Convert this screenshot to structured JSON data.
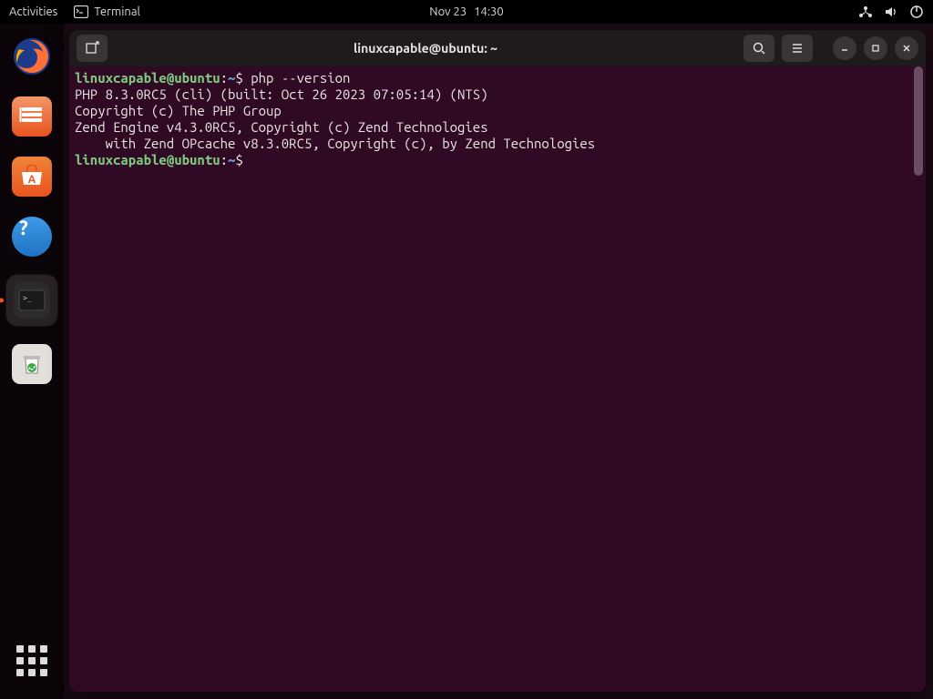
{
  "topbar": {
    "activities": "Activities",
    "app_label": "Terminal",
    "date": "Nov 23",
    "time": "14:30"
  },
  "dock": {
    "items": [
      {
        "name": "firefox",
        "label": "Firefox"
      },
      {
        "name": "files",
        "label": "Files"
      },
      {
        "name": "software",
        "label": "Ubuntu Software"
      },
      {
        "name": "help",
        "label": "Help"
      },
      {
        "name": "terminal",
        "label": "Terminal",
        "active": true
      },
      {
        "name": "trash",
        "label": "Trash"
      }
    ],
    "apps_button": "Show Applications"
  },
  "window": {
    "title": "linuxcapable@ubuntu: ~",
    "buttons": {
      "new_tab": "New Tab",
      "search": "Search",
      "menu": "Menu",
      "min": "Minimize",
      "max": "Maximize",
      "close": "Close"
    }
  },
  "terminal": {
    "prompt": {
      "user": "linuxcapable",
      "at": "@",
      "host": "ubuntu",
      "colon": ":",
      "path": "~",
      "sigil": "$"
    },
    "lines": [
      {
        "type": "prompt",
        "cmd": "php --version"
      },
      {
        "type": "out",
        "text": "PHP 8.3.0RC5 (cli) (built: Oct 26 2023 07:05:14) (NTS)"
      },
      {
        "type": "out",
        "text": "Copyright (c) The PHP Group"
      },
      {
        "type": "out",
        "text": "Zend Engine v4.3.0RC5, Copyright (c) Zend Technologies"
      },
      {
        "type": "out",
        "text": "    with Zend OPcache v8.3.0RC5, Copyright (c), by Zend Technologies"
      },
      {
        "type": "prompt",
        "cmd": ""
      }
    ]
  }
}
